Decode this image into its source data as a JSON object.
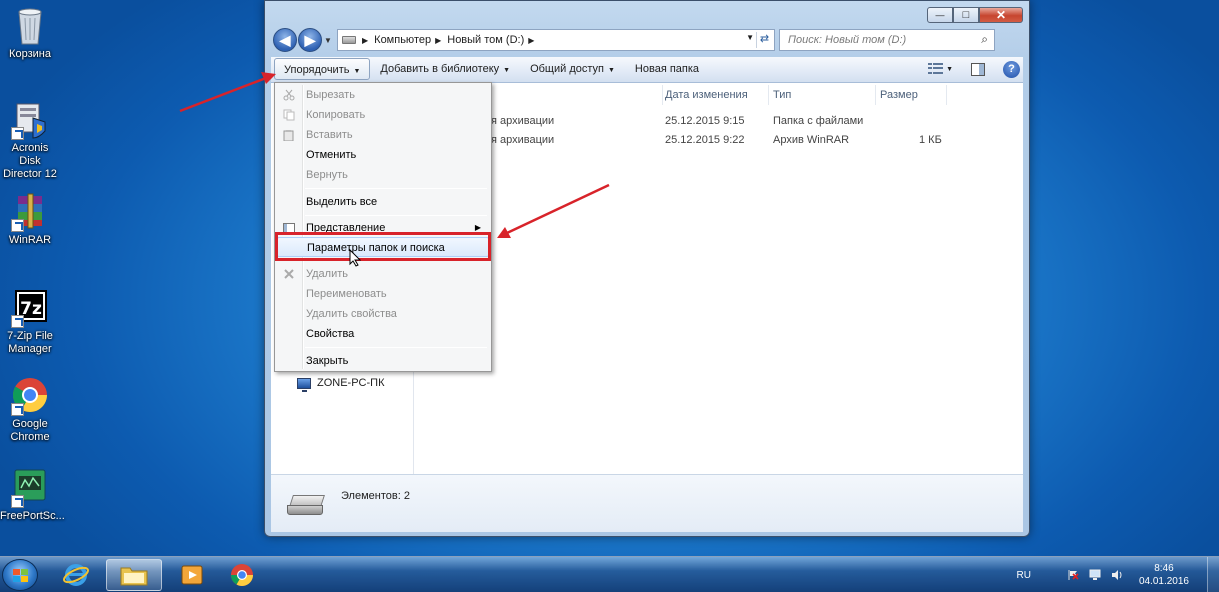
{
  "desktop": {
    "icons": [
      {
        "label": "Корзина"
      },
      {
        "label": "Acronis Disk Director 12"
      },
      {
        "label": "WinRAR"
      },
      {
        "label": "7-Zip File Manager"
      },
      {
        "label": "Google Chrome"
      },
      {
        "label": "FreePortSc..."
      }
    ]
  },
  "window": {
    "caption": {
      "minimize": "—",
      "maximize": "□",
      "close": "✕"
    },
    "address": {
      "segments": [
        "Компьютер",
        "Новый том (D:)"
      ]
    },
    "search": {
      "placeholder": "Поиск: Новый том (D:)"
    },
    "toolbar": {
      "organize": "Упорядочить",
      "add_to_library": "Добавить в библиотеку",
      "share": "Общий доступ",
      "new_folder": "Новая папка"
    },
    "columns": [
      "Дата изменения",
      "Тип",
      "Размер"
    ],
    "files": [
      {
        "name": "я архивации",
        "date": "25.12.2015 9:15",
        "type": "Папка с файлами",
        "size": ""
      },
      {
        "name": "я архивации",
        "date": "25.12.2015 9:22",
        "type": "Архив WinRAR",
        "size": "1 КБ"
      }
    ],
    "nav": {
      "computer": "ZONE-PC-ПК"
    },
    "details": {
      "count": "Элементов: 2"
    }
  },
  "menu": {
    "items": [
      {
        "label": "Вырезать",
        "enabled": false
      },
      {
        "label": "Копировать",
        "enabled": false
      },
      {
        "label": "Вставить",
        "enabled": false
      },
      {
        "label": "Отменить",
        "enabled": true
      },
      {
        "label": "Вернуть",
        "enabled": false
      },
      {
        "label": "Выделить все",
        "enabled": true
      },
      {
        "label": "Представление",
        "enabled": true,
        "submenu": true
      },
      {
        "label": "Параметры папок и поиска",
        "enabled": true,
        "highlighted": true
      },
      {
        "label": "Удалить",
        "enabled": false
      },
      {
        "label": "Переименовать",
        "enabled": false
      },
      {
        "label": "Удалить свойства",
        "enabled": false
      },
      {
        "label": "Свойства",
        "enabled": true
      },
      {
        "label": "Закрыть",
        "enabled": true
      }
    ]
  },
  "taskbar": {
    "language": "RU",
    "time": "8:46",
    "date": "04.01.2016"
  },
  "colors": {
    "annotation": "#d8232a",
    "accent": "#1f7fd0"
  }
}
